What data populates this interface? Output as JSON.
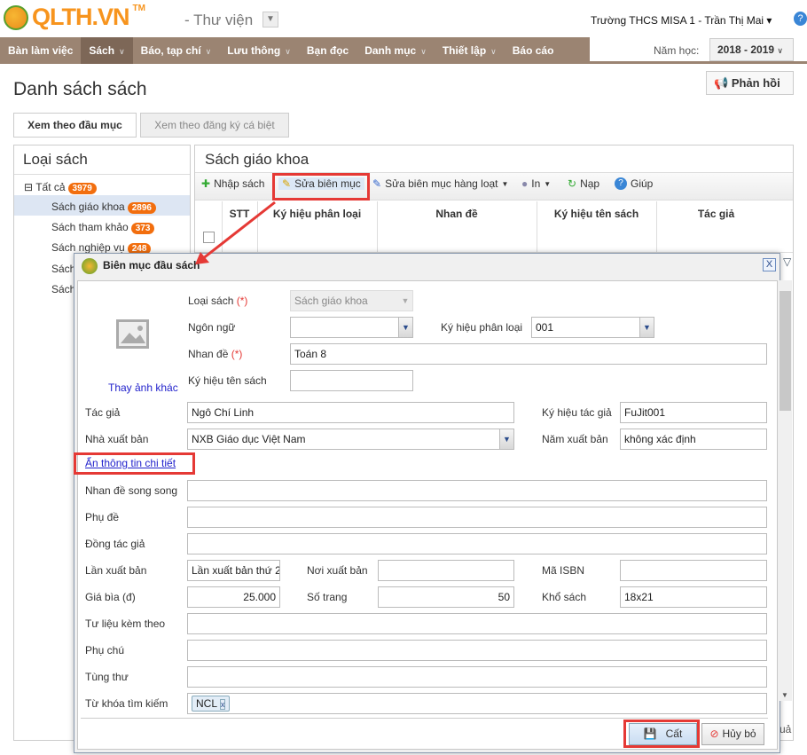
{
  "header": {
    "logo": "QLTH.VN",
    "tm": "TM",
    "app": "- Thư viện",
    "user": "Trường THCS MISA 1 - Trần Thị Mai",
    "help": "?"
  },
  "nav": {
    "items": [
      "Bàn làm việc",
      "Sách",
      "Báo, tạp chí",
      "Lưu thông",
      "Bạn đọc",
      "Danh mục",
      "Thiết lập",
      "Báo cáo"
    ],
    "year_label": "Năm học:",
    "year": "2018 - 2019"
  },
  "page": {
    "title": "Danh sách sách",
    "feedback": "Phản hồi",
    "tabs": [
      "Xem theo đầu mục",
      "Xem theo đăng ký cá biệt"
    ]
  },
  "left": {
    "title": "Loại sách",
    "all": "Tất cả",
    "all_count": "3979",
    "items": [
      {
        "label": "Sách giáo khoa",
        "count": "2896"
      },
      {
        "label": "Sách tham khảo",
        "count": "373"
      },
      {
        "label": "Sách nghiệp vụ",
        "count": "248"
      },
      {
        "label": "Sách"
      },
      {
        "label": "Sách"
      }
    ]
  },
  "right": {
    "title": "Sách giáo khoa",
    "toolbar": [
      "Nhập sách",
      "Sửa biên mục",
      "Sửa biên mục hàng loạt",
      "In",
      "Nạp",
      "Giúp"
    ],
    "columns": [
      "STT",
      "Ký hiệu phân loại",
      "Nhan đề",
      "Ký hiệu tên sách",
      "Tác giả"
    ],
    "footer_partial": "uả"
  },
  "dialog": {
    "title": "Biên mục đầu sách",
    "change_image": "Thay ảnh khác",
    "req": "(*)",
    "labels": {
      "loai_sach": "Loại sách",
      "ngon_ngu": "Ngôn ngữ",
      "ky_hieu_phan_loai": "Ký hiệu phân loại",
      "nhan_de": "Nhan đề",
      "ky_hieu_ten_sach": "Ký hiệu tên sách",
      "tac_gia": "Tác giả",
      "ky_hieu_tac_gia": "Ký hiệu tác giả",
      "nha_xuat_ban": "Nhà xuất bản",
      "nam_xuat_ban": "Năm xuất bản",
      "nhan_de_song_song": "Nhan đề song song",
      "phu_de": "Phụ đề",
      "dong_tac_gia": "Đồng tác giả",
      "lan_xuat_ban": "Lần xuất bản",
      "noi_xuat_ban": "Nơi xuất bản",
      "ma_isbn": "Mã ISBN",
      "gia_bia": "Giá bìa (đ)",
      "so_trang": "Số trang",
      "kho_sach": "Khổ sách",
      "tu_lieu": "Tư liệu kèm theo",
      "phu_chu": "Phụ chú",
      "tung_thu": "Tùng thư",
      "tu_khoa": "Từ khóa tìm kiếm"
    },
    "values": {
      "loai_sach": "Sách giáo khoa",
      "ngon_ngu": "",
      "ky_hieu_phan_loai": "001",
      "nhan_de": "Toán 8",
      "ky_hieu_ten_sach": "",
      "tac_gia": "Ngô Chí Linh",
      "ky_hieu_tac_gia": "FuJit001",
      "nha_xuat_ban": "NXB Giáo dục Việt Nam",
      "nam_xuat_ban": "không xác định",
      "lan_xuat_ban": "Lần xuất bản thứ 2",
      "gia_bia": "25.000",
      "so_trang": "50",
      "kho_sach": "18x21",
      "tag": "NCL"
    },
    "toggle_link": "Ẩn thông tin chi tiết",
    "save": "Cất",
    "cancel": "Hủy bỏ"
  },
  "colors": {
    "nav": "#9b8472",
    "accent": "#f7941d",
    "badge": "#f26e0e",
    "highlight": "#e53935"
  }
}
